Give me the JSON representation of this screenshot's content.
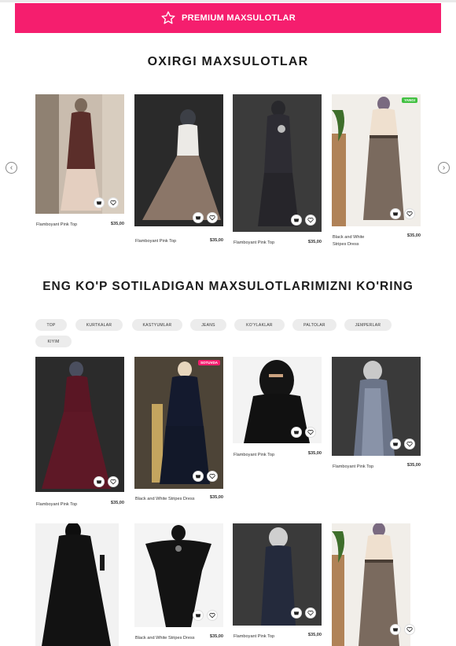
{
  "colors": {
    "accent": "#f51e6e",
    "new_badge": "#42c142",
    "sale_badge": "#f51e6e"
  },
  "banner": {
    "label": "PREMIUM MAXSULOTLAR",
    "icon": "star-icon"
  },
  "latest": {
    "title": "OXIRGI MAXSULOTLAR",
    "prev_icon": "chevron-left-icon",
    "next_icon": "chevron-right-icon",
    "items": [
      {
        "name": "Flamboyant Pink Top",
        "price": "$35,00"
      },
      {
        "name": "Flamboyant Pink Top",
        "price": "$35,00"
      },
      {
        "name": "Flamboyant Pink Top",
        "price": "$35,00"
      },
      {
        "name": "Black and White Stripes Dress",
        "price": "$35,00",
        "badge": "YANGI"
      }
    ]
  },
  "bestsellers": {
    "title": "ENG KO'P SOTILADIGAN MAXSULOTLARIMIZNI KO'RING",
    "filters": [
      "TOP",
      "KURTKALAR",
      "KASTYUMLAR",
      "JEANS",
      "KO'YLAKLAR",
      "PALTOLAR",
      "JEMPERLAR",
      "KIYIM"
    ],
    "row1": [
      {
        "name": "Flamboyant Pink Top",
        "price": "$35,00"
      },
      {
        "name": "Black and White Stripes Dress",
        "price": "$35,00",
        "badge": "SOTUVDA"
      },
      {
        "name": "Flamboyant Pink Top",
        "price": "$35,00"
      },
      {
        "name": "Flamboyant Pink Top",
        "price": "$35,00"
      }
    ],
    "row2": [
      {
        "name": "",
        "price": ""
      },
      {
        "name": "Black and White Stripes Dress",
        "price": "$35,00"
      },
      {
        "name": "Flamboyant Pink Top",
        "price": "$35,00"
      },
      {
        "name": "",
        "price": ""
      }
    ]
  },
  "card_icons": {
    "cart": "cart-icon",
    "wishlist": "heart-icon"
  }
}
